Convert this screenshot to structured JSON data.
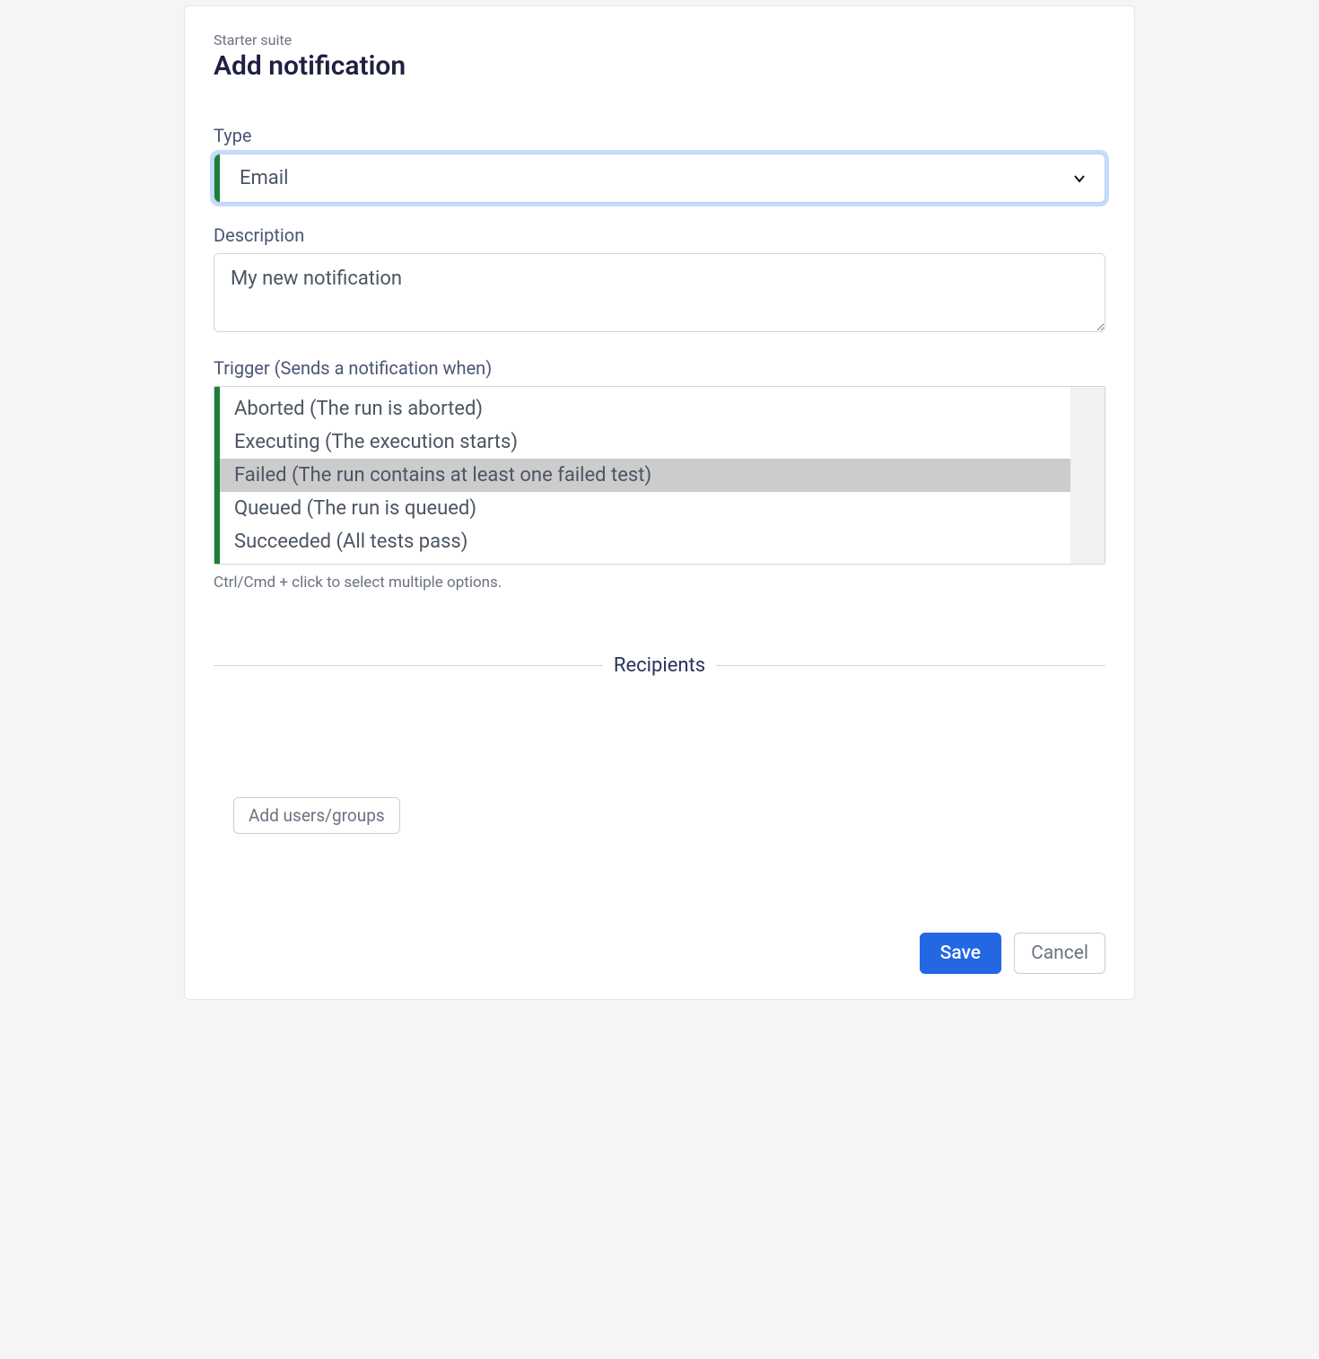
{
  "header": {
    "breadcrumb": "Starter suite",
    "title": "Add notification"
  },
  "form": {
    "type": {
      "label": "Type",
      "value": "Email"
    },
    "description": {
      "label": "Description",
      "value": "My new notification"
    },
    "trigger": {
      "label": "Trigger (Sends a notification when)",
      "options": [
        {
          "text": "Aborted (The run is aborted)",
          "selected": false
        },
        {
          "text": "Executing (The execution starts)",
          "selected": false
        },
        {
          "text": "Failed (The run contains at least one failed test)",
          "selected": true
        },
        {
          "text": "Queued (The run is queued)",
          "selected": false
        },
        {
          "text": "Succeeded (All tests pass)",
          "selected": false
        }
      ],
      "helper": "Ctrl/Cmd + click to select multiple options."
    }
  },
  "recipients": {
    "heading": "Recipients",
    "add_button": "Add users/groups"
  },
  "actions": {
    "save": "Save",
    "cancel": "Cancel"
  }
}
